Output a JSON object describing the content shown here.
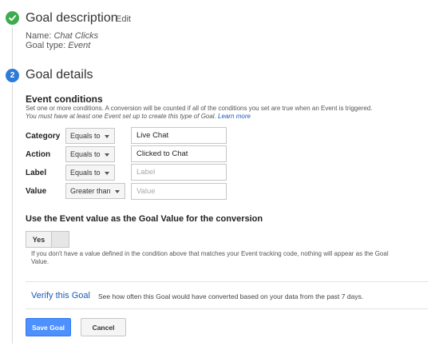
{
  "colors": {
    "accent": "#4d90fe",
    "success": "#3fab4f",
    "step_active": "#2d7ad8",
    "link": "#1a5ab6"
  },
  "goal_description": {
    "title": "Goal description",
    "edit_label": "Edit",
    "name_label": "Name:",
    "name_value": "Chat Clicks",
    "type_label": "Goal type:",
    "type_value": "Event",
    "icon": "check-icon"
  },
  "goal_details": {
    "step_number": "2",
    "title": "Goal details"
  },
  "event_conditions": {
    "heading": "Event conditions",
    "help_line1": "Set one or more conditions. A conversion will be counted if all of the conditions you set are true when an Event is triggered.",
    "help_line2": "You must have at least one Event set up to create this type of Goal.",
    "learn_more": "Learn more",
    "rows": [
      {
        "label": "Category",
        "operator": "Equals to",
        "value": "Live Chat",
        "placeholder": ""
      },
      {
        "label": "Action",
        "operator": "Equals to",
        "value": "Clicked to Chat",
        "placeholder": ""
      },
      {
        "label": "Label",
        "operator": "Equals to",
        "value": "",
        "placeholder": "Label"
      },
      {
        "label": "Value",
        "operator": "Greater than",
        "value": "",
        "placeholder": "Value"
      }
    ]
  },
  "goal_value": {
    "heading": "Use the Event value as the Goal Value for the conversion",
    "toggle_label": "Yes",
    "help_line1": "If you don't have a value defined in the condition above that matches your Event tracking code, nothing will appear as the Goal",
    "help_line2": "Value."
  },
  "verify": {
    "link": "Verify this Goal",
    "description": "See how often this Goal would have converted based on your data from the past 7 days."
  },
  "actions": {
    "save": "Save Goal",
    "cancel": "Cancel"
  }
}
